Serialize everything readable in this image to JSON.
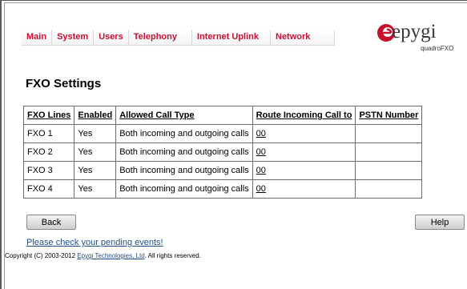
{
  "nav": {
    "items": [
      "Main",
      "System",
      "Users",
      "Telephony",
      "Internet Uplink",
      "Network"
    ]
  },
  "brand": {
    "logo_text": "epygi",
    "model": "quadroFXO"
  },
  "page": {
    "title": "FXO Settings"
  },
  "table": {
    "columns": [
      "FXO Lines",
      "Enabled",
      "Allowed Call Type",
      "Route Incoming Call to",
      "PSTN Number"
    ],
    "rows": [
      {
        "line": "FXO 1",
        "enabled": "Yes",
        "call_type": "Both incoming and outgoing calls",
        "route": "00",
        "pstn": ""
      },
      {
        "line": "FXO 2",
        "enabled": "Yes",
        "call_type": "Both incoming and outgoing calls",
        "route": "00",
        "pstn": ""
      },
      {
        "line": "FXO 3",
        "enabled": "Yes",
        "call_type": "Both incoming and outgoing calls",
        "route": "00",
        "pstn": ""
      },
      {
        "line": "FXO 4",
        "enabled": "Yes",
        "call_type": "Both incoming and outgoing calls",
        "route": "00",
        "pstn": ""
      }
    ]
  },
  "buttons": {
    "back": "Back",
    "help": "Help"
  },
  "footer": {
    "pending_link": "Please check your pending events!",
    "copyright_prefix": "Copyright (C) 2003-2012 ",
    "company_link": "Epygi Technologies, Ltd",
    "copyright_suffix": ". All rights reserved."
  },
  "colors": {
    "nav_text": "#c8102e",
    "logo_accent": "#c8102e",
    "link": "#1f4f8f"
  }
}
